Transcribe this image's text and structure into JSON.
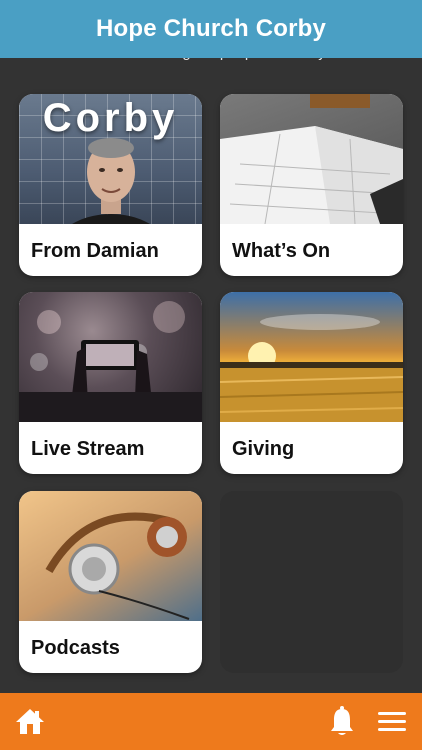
{
  "header": {
    "title": "Hope Church Corby"
  },
  "tagline": "church serving the people of Corby.",
  "tiles": [
    {
      "label": "From Damian",
      "image_icon": "portrait-photo",
      "image_text": "Corby"
    },
    {
      "label": "What’s On",
      "image_icon": "calendar-photo"
    },
    {
      "label": "Live Stream",
      "image_icon": "concert-photo"
    },
    {
      "label": "Giving",
      "image_icon": "wheat-field-photo"
    },
    {
      "label": "Podcasts",
      "image_icon": "headphones-photo"
    }
  ],
  "bottom_bar": {
    "home_icon": "home-icon",
    "bell_icon": "bell-icon",
    "menu_icon": "menu-icon"
  },
  "colors": {
    "header_bg": "#4a9fc4",
    "background": "#333333",
    "bottom_bar_bg": "#ee7a1c",
    "tile_bg": "#ffffff"
  }
}
